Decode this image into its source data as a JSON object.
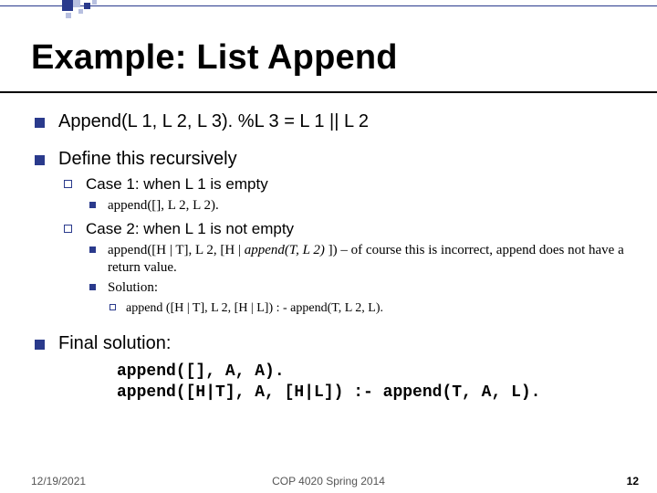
{
  "title": "Example: List Append",
  "bullets": {
    "b1": "Append(L 1, L 2, L 3). %L 3 = L 1 || L 2",
    "b2": "Define this recursively",
    "b2c1": "Case 1: when L 1 is empty",
    "b2c1d1": "append([], L 2, L 2).",
    "b2c2": "Case 2: when L 1 is not empty",
    "b2c2d1a": "append([H | T], L 2, [H | ",
    "b2c2d1b": "append(T, L 2)",
    "b2c2d1c": " ]) – of course this is incorrect, append does not have a return value.",
    "b2c2d2": "Solution:",
    "b2c2d2e1": "append ([H | T], L 2, [H | L]) : - append(T, L 2, L).",
    "b3": "Final solution:"
  },
  "code": {
    "line1": "append([], A, A).",
    "line2": "append([H|T], A, [H|L]) :- append(T, A, L)."
  },
  "footer": {
    "date": "12/19/2021",
    "course": "COP 4020 Spring 2014",
    "page": "12"
  }
}
